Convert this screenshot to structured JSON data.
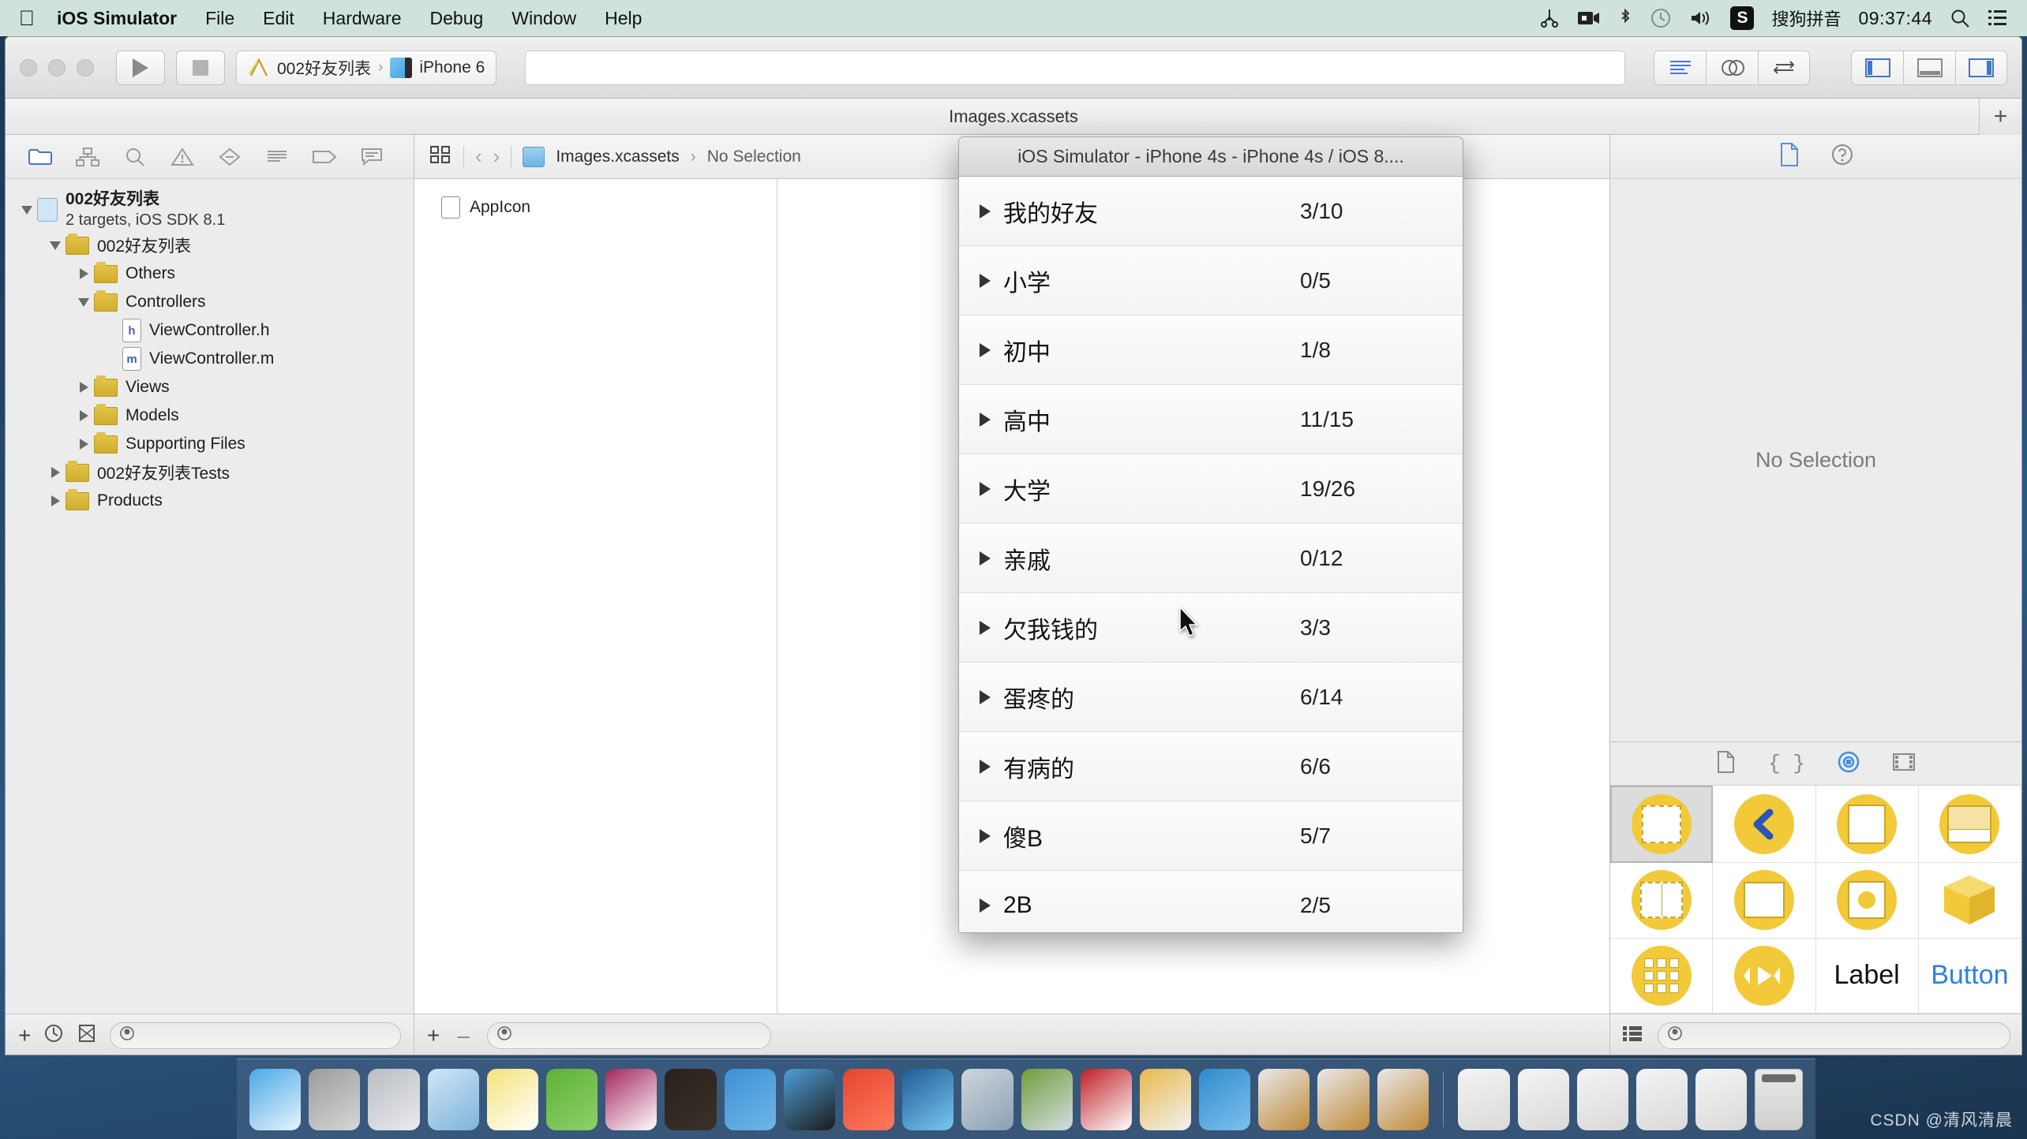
{
  "menubar": {
    "apple_glyph": "&#63743;",
    "app_name": "iOS Simulator",
    "items": [
      "File",
      "Edit",
      "Hardware",
      "Debug",
      "Window",
      "Help"
    ],
    "status_icons": [
      "cut-icon",
      "screen-record-icon",
      "bluetooth-icon",
      "time-machine-icon",
      "volume-icon"
    ],
    "ime_badge": "S",
    "ime_name": "搜狗拼音",
    "time": "09:37:44",
    "search_icon": "search-icon",
    "notification_icon": "notification-center-icon"
  },
  "xcode": {
    "toolbar": {
      "run_button": "run-button",
      "stop_button": "stop-button",
      "scheme_name": "002好友列表",
      "scheme_separator": "›",
      "destination": "iPhone 6",
      "search_placeholder": "",
      "editor_modes": [
        "standard-editor",
        "assistant-editor",
        "version-editor"
      ],
      "panel_toggles": [
        "navigator-toggle",
        "debug-area-toggle",
        "utilities-toggle"
      ]
    },
    "tabbar": {
      "title": "Images.xcassets",
      "add_tab": "+"
    },
    "navigator": {
      "tool_icons": [
        "project-navigator-icon",
        "symbol-navigator-icon",
        "find-navigator-icon",
        "issue-navigator-icon",
        "test-navigator-icon",
        "debug-navigator-icon",
        "breakpoint-navigator-icon",
        "report-navigator-icon"
      ],
      "tree": [
        {
          "label": "002好友列表",
          "sub": "2 targets, iOS SDK 8.1",
          "type": "project",
          "depth": 0,
          "twisty": "down"
        },
        {
          "label": "002好友列表",
          "type": "folder",
          "depth": 1,
          "twisty": "down"
        },
        {
          "label": "Others",
          "type": "folder",
          "depth": 2,
          "twisty": "right"
        },
        {
          "label": "Controllers",
          "type": "folder",
          "depth": 2,
          "twisty": "down"
        },
        {
          "label": "ViewController.h",
          "type": "file-h",
          "depth": 3,
          "twisty": "none"
        },
        {
          "label": "ViewController.m",
          "type": "file-m",
          "depth": 3,
          "twisty": "none"
        },
        {
          "label": "Views",
          "type": "folder",
          "depth": 2,
          "twisty": "right"
        },
        {
          "label": "Models",
          "type": "folder",
          "depth": 2,
          "twisty": "right"
        },
        {
          "label": "Supporting Files",
          "type": "folder",
          "depth": 2,
          "twisty": "right"
        },
        {
          "label": "002好友列表Tests",
          "type": "folder",
          "depth": 1,
          "twisty": "right"
        },
        {
          "label": "Products",
          "type": "folder",
          "depth": 1,
          "twisty": "right"
        }
      ],
      "bottom_bar": {
        "add": "+",
        "icons": [
          "recent-icon",
          "source-control-icon"
        ],
        "filter_placeholder": ""
      }
    },
    "editor": {
      "jumpbar": {
        "related_items_icon": "related-items-icon",
        "back_icon": "back-chevron-icon",
        "forward_icon": "forward-chevron-icon",
        "crumb_file": "Images.xcassets",
        "crumb_separator": "›",
        "crumb_selection": "No Selection"
      },
      "assets": [
        {
          "name": "AppIcon",
          "icon": "appicon-thumb"
        }
      ],
      "bottom_bar": {
        "add": "+",
        "remove": "–",
        "filter_placeholder": ""
      }
    },
    "utilities": {
      "inspector_tabs": [
        "file-inspector-icon",
        "quick-help-icon"
      ],
      "inspector_empty": "No Selection",
      "library_tabs": [
        "file-template-library-icon",
        "code-snippet-library-icon",
        "object-library-icon",
        "media-library-icon"
      ],
      "library_items": [
        {
          "name": "view-object",
          "label": "",
          "selected": true
        },
        {
          "name": "back-button-object",
          "label": ""
        },
        {
          "name": "table-view-object",
          "label": ""
        },
        {
          "name": "table-view-cell-object",
          "label": ""
        },
        {
          "name": "split-view-object",
          "label": ""
        },
        {
          "name": "scroll-view-object",
          "label": ""
        },
        {
          "name": "image-view-object",
          "label": ""
        },
        {
          "name": "object-cube",
          "label": ""
        },
        {
          "name": "collection-view-object",
          "label": ""
        },
        {
          "name": "media-player-object",
          "label": ""
        },
        {
          "name": "label-object",
          "label": "Label"
        },
        {
          "name": "button-object",
          "label": "Button"
        }
      ],
      "library_bottom": {
        "layout_icon": "list-layout-icon",
        "filter_placeholder": ""
      }
    }
  },
  "simulator": {
    "window_title": "iOS Simulator - iPhone 4s - iPhone 4s / iOS 8....",
    "rows": [
      {
        "name": "我的好友",
        "count": "3/10"
      },
      {
        "name": "小学",
        "count": "0/5"
      },
      {
        "name": "初中",
        "count": "1/8"
      },
      {
        "name": "高中",
        "count": "11/15"
      },
      {
        "name": "大学",
        "count": "19/26"
      },
      {
        "name": "亲戚",
        "count": "0/12"
      },
      {
        "name": "欠我钱的",
        "count": "3/3"
      },
      {
        "name": "蛋疼的",
        "count": "6/14"
      },
      {
        "name": "有病的",
        "count": "6/6"
      },
      {
        "name": "傻B",
        "count": "5/7"
      },
      {
        "name": "2B",
        "count": "2/5"
      }
    ]
  },
  "dock": {
    "apps": [
      {
        "name": "finder-icon",
        "color1": "#49a8e8",
        "color2": "#e8f4fc"
      },
      {
        "name": "system-preferences-icon",
        "color1": "#9b9b9b",
        "color2": "#d7d7d7"
      },
      {
        "name": "launchpad-icon",
        "color1": "#b9bcc2",
        "color2": "#e9ebee"
      },
      {
        "name": "safari-icon",
        "color1": "#cfe6f7",
        "color2": "#7fb3da"
      },
      {
        "name": "notes-icon",
        "color1": "#f6e27a",
        "color2": "#ffffff"
      },
      {
        "name": "excel-icon",
        "color1": "#5cb238",
        "color2": "#8ed06a"
      },
      {
        "name": "onenote-icon",
        "color1": "#a3265e",
        "color2": "#ffffff"
      },
      {
        "name": "terminal-icon",
        "color1": "#2a211c",
        "color2": "#3b312a"
      },
      {
        "name": "xcode-icon",
        "color1": "#3d90d4",
        "color2": "#6fb6e8"
      },
      {
        "name": "ios-simulator-icon",
        "color1": "#4e9ed8",
        "color2": "#1b1b1b"
      },
      {
        "name": "parallels-icon",
        "color1": "#e5452f",
        "color2": "#ff7a5c"
      },
      {
        "name": "snagit-icon",
        "color1": "#1e5d96",
        "color2": "#79c6f2"
      },
      {
        "name": "camtasia-icon",
        "color1": "#cfd6dd",
        "color2": "#8aa0b4"
      },
      {
        "name": "fifo-icon",
        "color1": "#6f9e3a",
        "color2": "#d5dde3"
      },
      {
        "name": "filezilla-icon",
        "color1": "#bf2024",
        "color2": "#ffffff"
      },
      {
        "name": "graphics-app-icon",
        "color1": "#e8b84a",
        "color2": "#f2f2f2"
      },
      {
        "name": "wps-icon",
        "color1": "#2f8ccb",
        "color2": "#7ec0ee"
      },
      {
        "name": "xcode-alt-icon",
        "color1": "#e9e9e9",
        "color2": "#c08a3a"
      },
      {
        "name": "xcode-beta-icon",
        "color1": "#e9e9e9",
        "color2": "#c08a3a"
      },
      {
        "name": "xcode-beta2-icon",
        "color1": "#e9e9e9",
        "color2": "#c08a3a"
      }
    ],
    "recents": [
      {
        "name": "recent-window-safari"
      },
      {
        "name": "recent-window-xcode-1"
      },
      {
        "name": "recent-window-xcode-2"
      },
      {
        "name": "recent-window-xcode-3"
      },
      {
        "name": "recent-window-display"
      }
    ],
    "trash": "trash-icon"
  },
  "watermark": "CSDN @清风清晨"
}
